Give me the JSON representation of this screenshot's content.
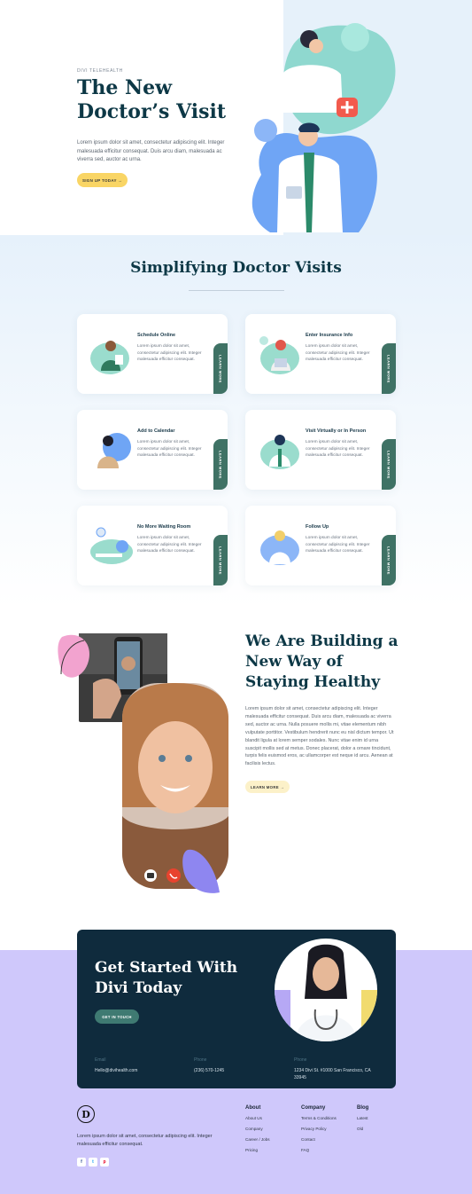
{
  "colors": {
    "navy": "#0d3846",
    "yellow": "#f9d565",
    "teal": "#3f7265",
    "lilac": "#cfc8fb",
    "dark": "#0f2b3d"
  },
  "hero": {
    "eyebrow": "DIVI TELEHEALTH",
    "title_line1": "The New",
    "title_line2": "Doctor’s Visit",
    "text": "Lorem ipsum dolor sit amet, consectetur adipiscing elit. Integer malesuada efficitur consequat. Duis arcu diam, malesuada ac viverra sed, auctor ac urna.",
    "button": "SIGN UP TODAY →"
  },
  "features": {
    "title": "Simplifying Doctor Visits",
    "tab_label": "LEARN MORE",
    "card_text": "Lorem ipsum dolor sit amet, consectetur adipiscing elit. Integer malesuada efficitur consequat.",
    "cards": [
      {
        "title": "Schedule Online",
        "icon": "doctor-tablet-icon"
      },
      {
        "title": "Enter Insurance Info",
        "icon": "insurance-form-icon"
      },
      {
        "title": "Add to Calendar",
        "icon": "patient-calendar-icon"
      },
      {
        "title": "Visit Virtually or In Person",
        "icon": "video-visit-icon"
      },
      {
        "title": "No More Waiting Room",
        "icon": "waiting-room-icon"
      },
      {
        "title": "Follow Up",
        "icon": "follow-up-icon"
      }
    ]
  },
  "building": {
    "title_line1": "We Are Building a",
    "title_line2": "New Way of",
    "title_line3": "Staying Healthy",
    "text": "Lorem ipsum dolor sit amet, consectetur adipiscing elit. Integer malesuada efficitur consequat. Duis arcu diam, malesuada ac viverra sed, auctor ac urna. Nulla posuere mollis mi, vitae elementum nibh vulputate porttitor. Vestibulum hendrerit nunc eu nisl dictum tempor. Ut blandit ligula at lorem semper sodales. Nunc vitae enim id urna suscipit mollis sed at metus. Donec placerat, dolor a ornare tincidunt, turpis felis euismod eros, ac ullamcorper est neque id arcu. Aenean at facilisis lectus.",
    "button": "LEARN MORE →"
  },
  "cta": {
    "title_line1": "Get Started With",
    "title_line2": "Divi Today",
    "button": "GET IN TOUCH",
    "email_label": "Email",
    "email": "Hello@divihealth.com",
    "phone_label": "Phone",
    "phone": "(236) 570-1245",
    "address_label": "Phone",
    "address": "1234 Divi St. #1000 San Francisco, CA 33945"
  },
  "footer": {
    "logo": "D",
    "text": "Lorem ipsum dolor sit amet, consectetur adipiscing elit. Integer malesuada efficitur consequat.",
    "social": [
      "f",
      "t",
      "p"
    ],
    "about": {
      "heading": "About",
      "links": [
        "About Us",
        "Company",
        "Career / Jobs",
        "Pricing"
      ]
    },
    "company": {
      "heading": "Company",
      "links": [
        "Terms & Conditions",
        "Privacy Policy",
        "Contact",
        "FAQ"
      ]
    },
    "blog": {
      "heading": "Blog",
      "links": [
        "Latest",
        "Old"
      ]
    }
  }
}
